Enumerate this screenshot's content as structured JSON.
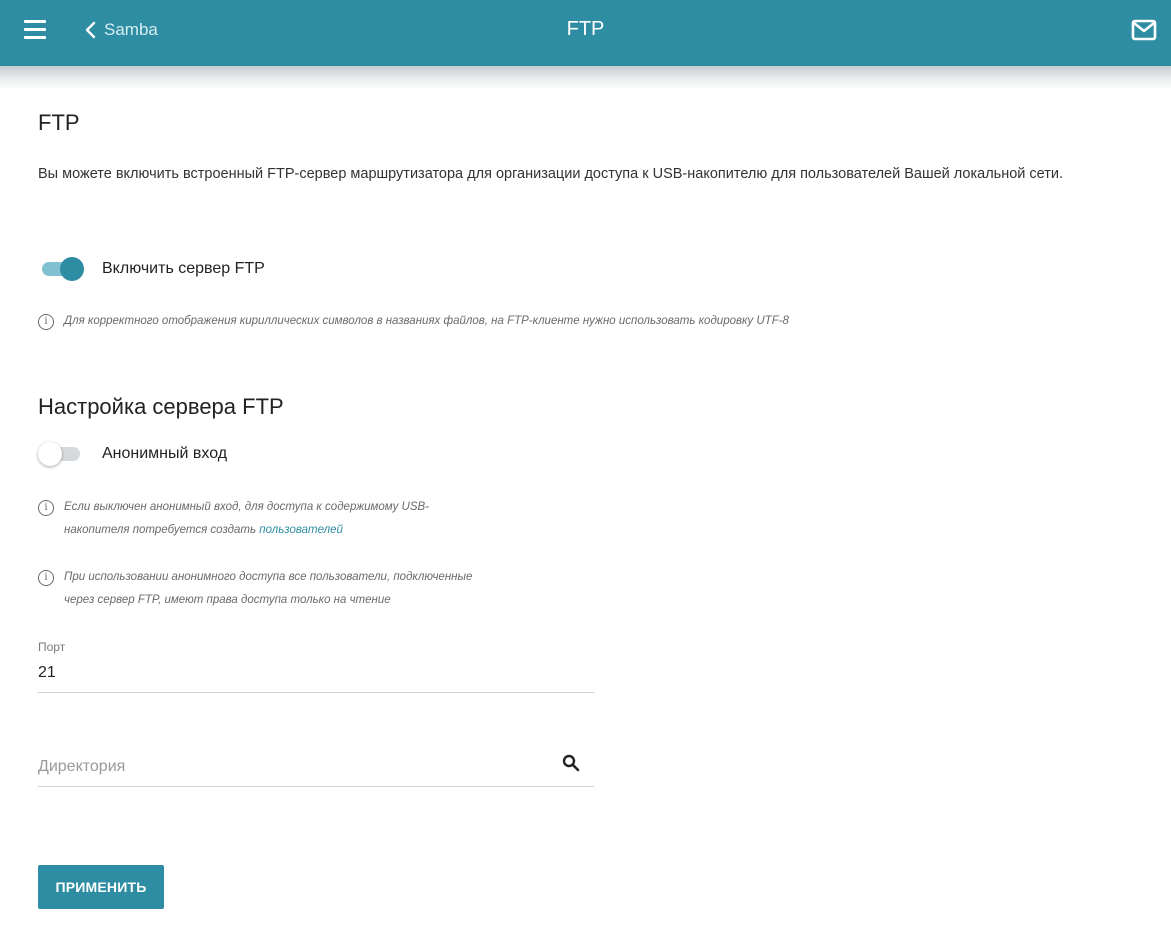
{
  "header": {
    "title": "FTP",
    "back_label": "Samba",
    "colors": {
      "accent": "#2e8da2"
    }
  },
  "main": {
    "section_title": "FTP",
    "intro_text": "Вы можете включить встроенный FTP-сервер маршрутизатора для организации доступа к USB-накопителю для пользователей Вашей локальной сети.",
    "enable_toggle": {
      "label": "Включить сервер FTP",
      "checked": true
    },
    "encoding_note": "Для корректного отображения кириллических символов в названиях файлов, на FTP-клиенте нужно использовать кодировку UTF-8",
    "settings_title": "Настройка сервера FTP",
    "anonymous_toggle": {
      "label": "Анонимный вход",
      "checked": false
    },
    "anonymous_note": {
      "line1": "Если выключен анонимный вход, для доступа к содержимому USB-",
      "line2_prefix": "накопителя потребуется создать ",
      "line2_link": "пользователей"
    },
    "readonly_note": {
      "line1": "При использовании анонимного доступа все пользователи, подключенные",
      "line2": "через сервер FTP, имеют права доступа только на чтение"
    },
    "port": {
      "label": "Порт",
      "value": "21"
    },
    "directory": {
      "placeholder": "Директория",
      "value": ""
    },
    "apply_label": "ПРИМЕНИТЬ"
  },
  "icons": [
    "menu-icon",
    "chevron-left-icon",
    "mail-icon",
    "info-icon",
    "search-icon"
  ]
}
